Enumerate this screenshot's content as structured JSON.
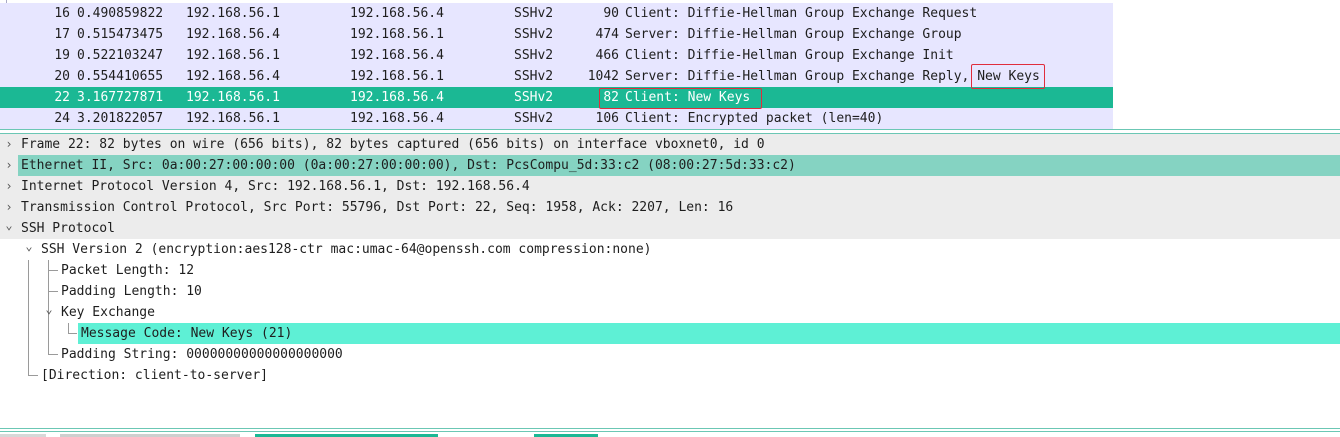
{
  "packet_list": {
    "rows": [
      {
        "no": "16",
        "time": "0.490859822",
        "src": "192.168.56.1",
        "dst": "192.168.56.4",
        "proto": "SSHv2",
        "len": "90",
        "info": "Client: Diffie-Hellman Group Exchange Request"
      },
      {
        "no": "17",
        "time": "0.515473475",
        "src": "192.168.56.4",
        "dst": "192.168.56.1",
        "proto": "SSHv2",
        "len": "474",
        "info": "Server: Diffie-Hellman Group Exchange Group"
      },
      {
        "no": "19",
        "time": "0.522103247",
        "src": "192.168.56.1",
        "dst": "192.168.56.4",
        "proto": "SSHv2",
        "len": "466",
        "info": "Client: Diffie-Hellman Group Exchange Init"
      },
      {
        "no": "20",
        "time": "0.554410655",
        "src": "192.168.56.4",
        "dst": "192.168.56.1",
        "proto": "SSHv2",
        "len": "1042",
        "info": "Server: Diffie-Hellman Group Exchange Reply, New Keys"
      },
      {
        "no": "22",
        "time": "3.167727871",
        "src": "192.168.56.1",
        "dst": "192.168.56.4",
        "proto": "SSHv2",
        "len": "82",
        "info": "Client: New Keys"
      },
      {
        "no": "24",
        "time": "3.201822057",
        "src": "192.168.56.1",
        "dst": "192.168.56.4",
        "proto": "SSHv2",
        "len": "106",
        "info": "Client: Encrypted packet (len=40)"
      }
    ],
    "selected_row_no": "22",
    "colors": {
      "row_bg": "#e7e6ff",
      "selected_bg": "#1bb894",
      "highlight_box": "#e02d3c"
    }
  },
  "details": {
    "frame": "Frame 22: 82 bytes on wire (656 bits), 82 bytes captured (656 bits) on interface vboxnet0, id 0",
    "ethernet": "Ethernet II, Src: 0a:00:27:00:00:00 (0a:00:27:00:00:00), Dst: PcsCompu_5d:33:c2 (08:00:27:5d:33:c2)",
    "ip": "Internet Protocol Version 4, Src: 192.168.56.1, Dst: 192.168.56.4",
    "tcp": "Transmission Control Protocol, Src Port: 55796, Dst Port: 22, Seq: 1958, Ack: 2207, Len: 16",
    "ssh": "SSH Protocol",
    "ssh_version": "SSH Version 2 (encryption:aes128-ctr mac:umac-64@openssh.com compression:none)",
    "packet_length": "Packet Length: 12",
    "padding_length": "Padding Length: 10",
    "key_exchange": "Key Exchange",
    "message_code": "Message Code: New Keys (21)",
    "padding_string": "Padding String: 00000000000000000000",
    "direction": "[Direction: client-to-server]",
    "collapsed_glyph": "›",
    "expanded_glyph": "⌄"
  }
}
